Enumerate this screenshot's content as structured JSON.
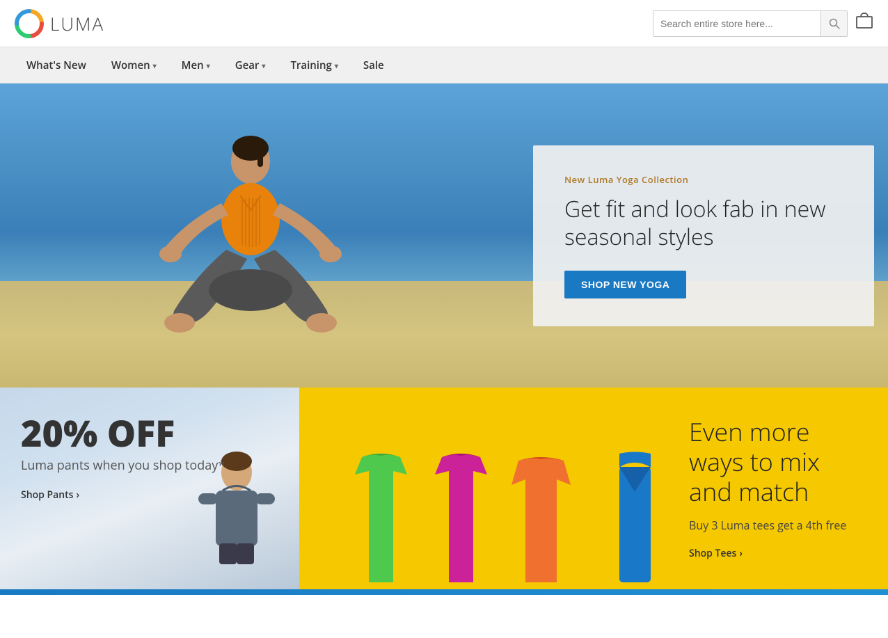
{
  "header": {
    "logo_text": "LUMA",
    "search_placeholder": "Search entire store here...",
    "search_icon": "🔍",
    "cart_icon": "🛒"
  },
  "nav": {
    "items": [
      {
        "label": "What's New",
        "has_dropdown": false
      },
      {
        "label": "Women",
        "has_dropdown": true
      },
      {
        "label": "Men",
        "has_dropdown": true
      },
      {
        "label": "Gear",
        "has_dropdown": true
      },
      {
        "label": "Training",
        "has_dropdown": true
      },
      {
        "label": "Sale",
        "has_dropdown": false
      }
    ]
  },
  "hero": {
    "promo_subtitle": "New Luma Yoga Collection",
    "promo_title": "Get fit and look fab in new seasonal styles",
    "promo_button": "Shop New Yoga"
  },
  "banner_pants": {
    "percent": "20% OFF",
    "text": "Luma pants when you shop today*",
    "link": "Shop Pants",
    "link_arrow": "›"
  },
  "banner_tees": {
    "title": "Even more ways to mix and match",
    "subtitle": "Buy 3 Luma tees get a 4th free",
    "link": "Shop Tees",
    "link_arrow": "›"
  }
}
